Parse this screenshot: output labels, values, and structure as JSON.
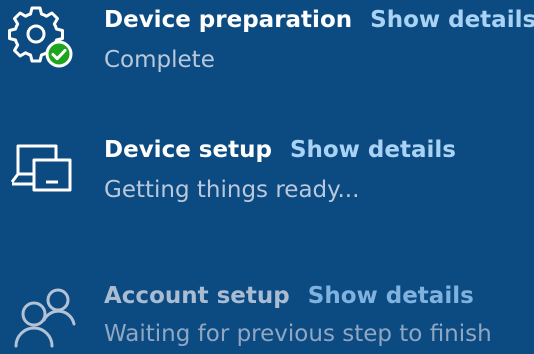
{
  "colors": {
    "background": "#0c4a82",
    "title": "#ffffff",
    "link": "#a9d3f5",
    "status": "#b9c9dc",
    "success": "#1ea51e"
  },
  "steps": [
    {
      "icon": "gear-check-icon",
      "title": "Device preparation",
      "details_label": "Show details",
      "status": "Complete"
    },
    {
      "icon": "devices-icon",
      "title": "Device setup",
      "details_label": "Show details",
      "status": "Getting things ready..."
    },
    {
      "icon": "people-icon",
      "title": "Account setup",
      "details_label": "Show details",
      "status": "Waiting for previous step to finish"
    }
  ]
}
